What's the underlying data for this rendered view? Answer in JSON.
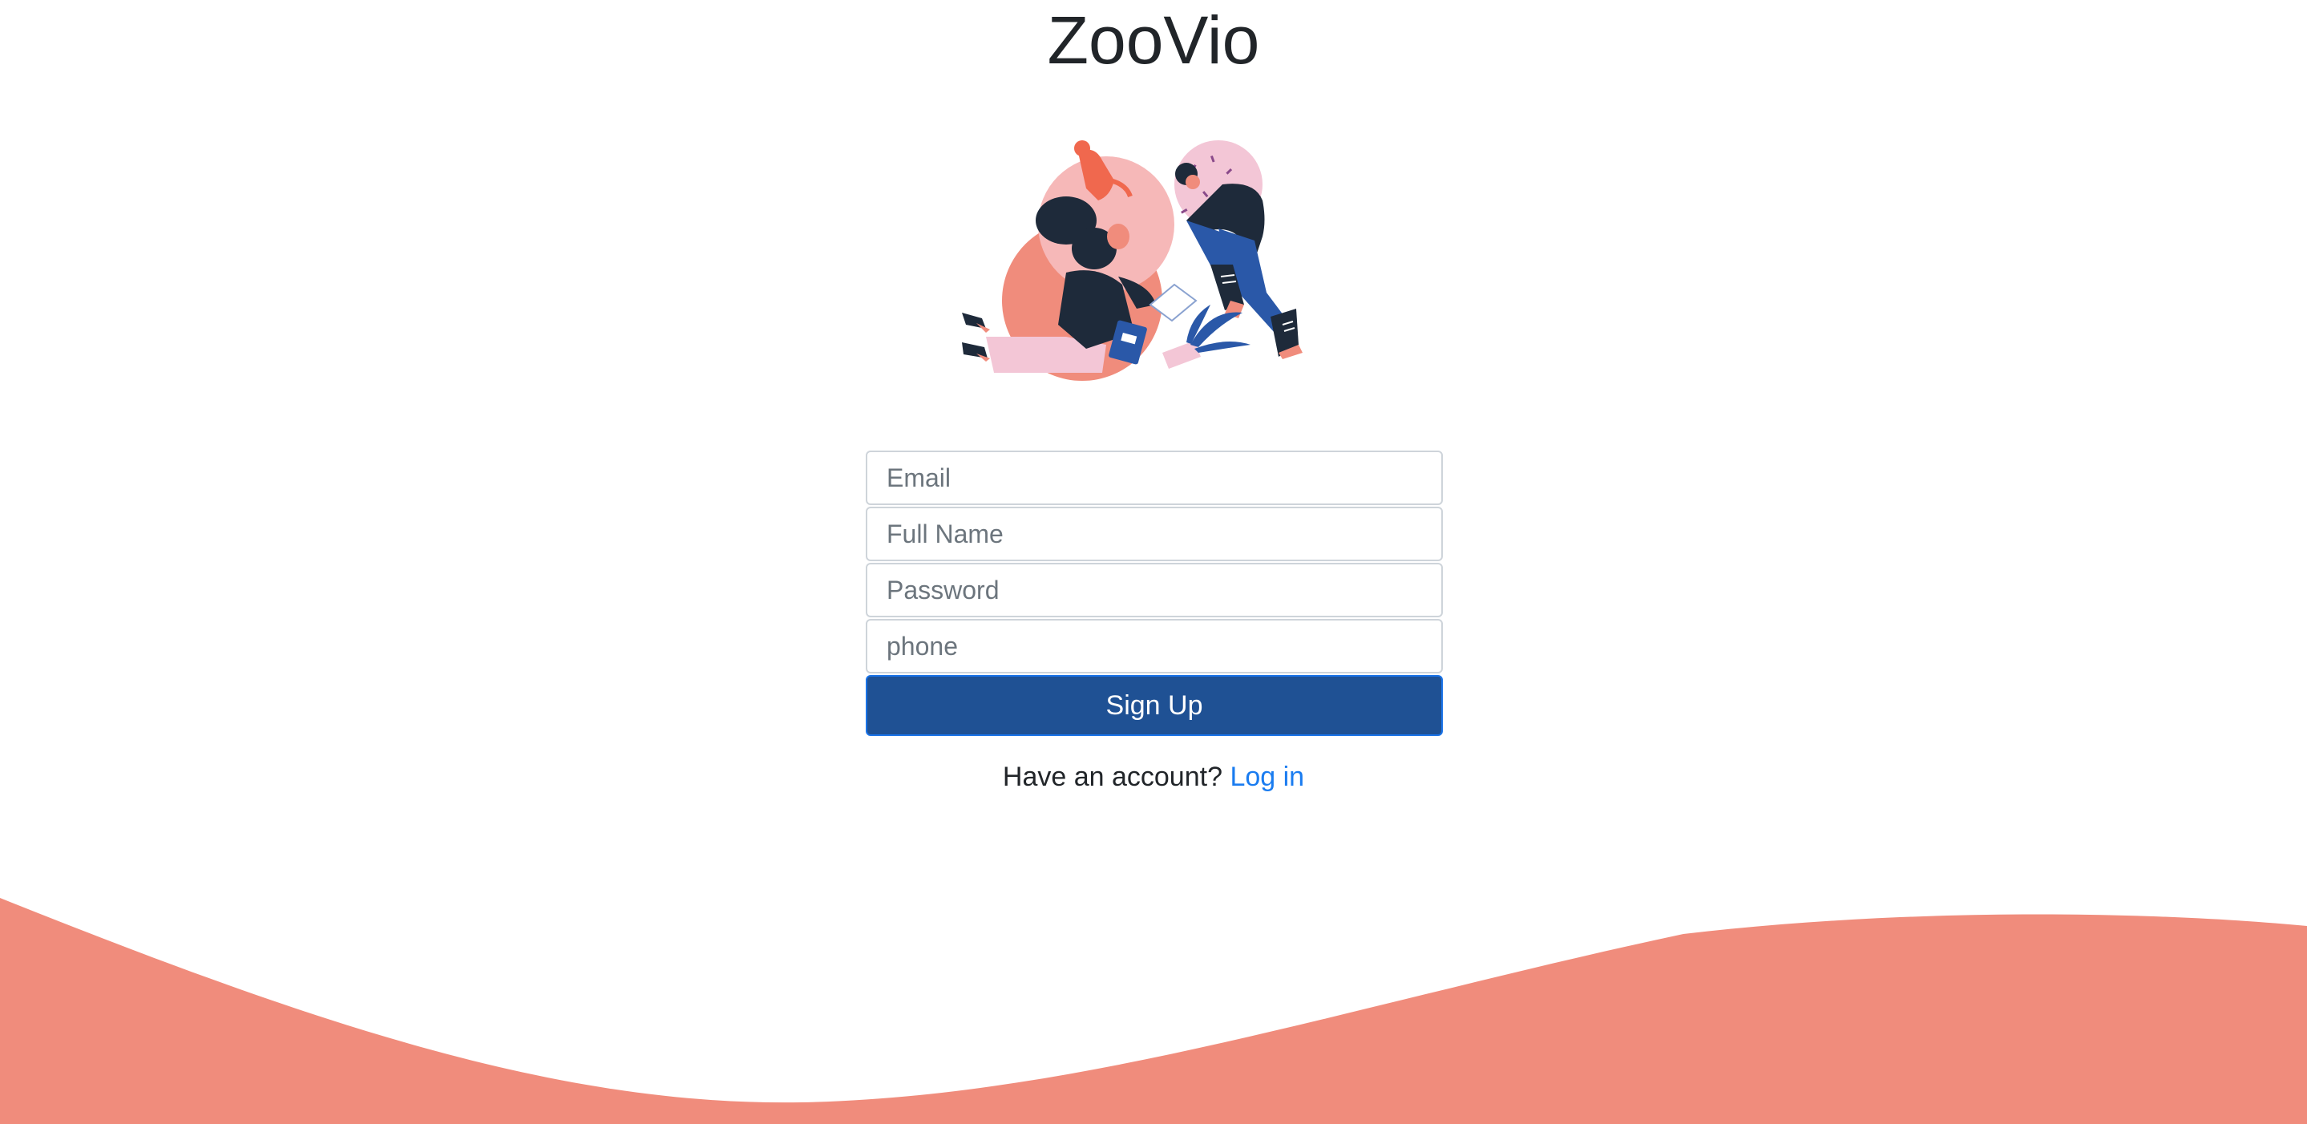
{
  "app": {
    "title": "ZooVio"
  },
  "signup_form": {
    "email_placeholder": "Email",
    "fullname_placeholder": "Full Name",
    "password_placeholder": "Password",
    "phone_placeholder": "phone",
    "submit_label": "Sign Up"
  },
  "login_prompt": {
    "text": "Have an account?",
    "link_label": "Log in"
  },
  "colors": {
    "button_bg": "#1f5194",
    "link": "#1a7cf0",
    "wave": "#f08c7c"
  },
  "illustration": {
    "icon": "people-reading-illustration"
  }
}
